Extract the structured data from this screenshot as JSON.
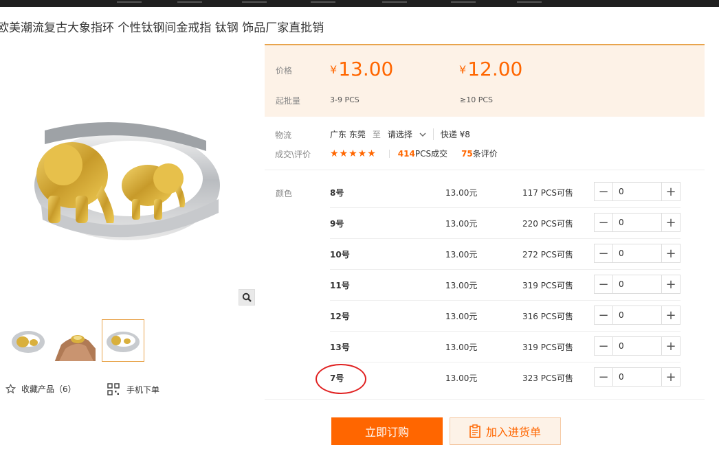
{
  "product": {
    "title": "欧美潮流复古大象指环 个性钛钢间金戒指 钛钢 饰品厂家直批销",
    "favorite_label": "收藏产品（6）",
    "mobile_order_label": "手机下单"
  },
  "price": {
    "label_price": "价格",
    "label_moq": "起批量",
    "currency": "¥",
    "tiers": [
      {
        "price": "13.00",
        "range": "3-9  PCS"
      },
      {
        "price": "12.00",
        "range": "≥10  PCS"
      }
    ]
  },
  "logistics": {
    "label": "物流",
    "origin": "广东 东莞",
    "to": "至",
    "destination": "请选择",
    "shipping": "快递 ¥8"
  },
  "deals": {
    "label": "成交\\评价",
    "stars": "★★★★★",
    "count": "414",
    "count_suffix": "PCS成交",
    "reviews": "75",
    "reviews_suffix": "条评价"
  },
  "sku": {
    "label": "颜色",
    "rows": [
      {
        "size": "8号",
        "price": "13.00元",
        "stock": "117 PCS可售",
        "qty": "0"
      },
      {
        "size": "9号",
        "price": "13.00元",
        "stock": "220 PCS可售",
        "qty": "0"
      },
      {
        "size": "10号",
        "price": "13.00元",
        "stock": "272 PCS可售",
        "qty": "0"
      },
      {
        "size": "11号",
        "price": "13.00元",
        "stock": "319 PCS可售",
        "qty": "0"
      },
      {
        "size": "12号",
        "price": "13.00元",
        "stock": "316 PCS可售",
        "qty": "0"
      },
      {
        "size": "13号",
        "price": "13.00元",
        "stock": "319 PCS可售",
        "qty": "0"
      },
      {
        "size": "7号",
        "price": "13.00元",
        "stock": "323 PCS可售",
        "qty": "0"
      }
    ]
  },
  "actions": {
    "buy_now": "立即订购",
    "add_to_list": "加入进货单"
  },
  "icons": {
    "zoom": "magnifier-icon",
    "star": "star-outline-icon",
    "qr": "qr-code-icon",
    "clipboard": "clipboard-icon"
  },
  "colors": {
    "accent": "#ff6600",
    "price_bg": "#fdf2e7",
    "circle": "#e02020"
  }
}
